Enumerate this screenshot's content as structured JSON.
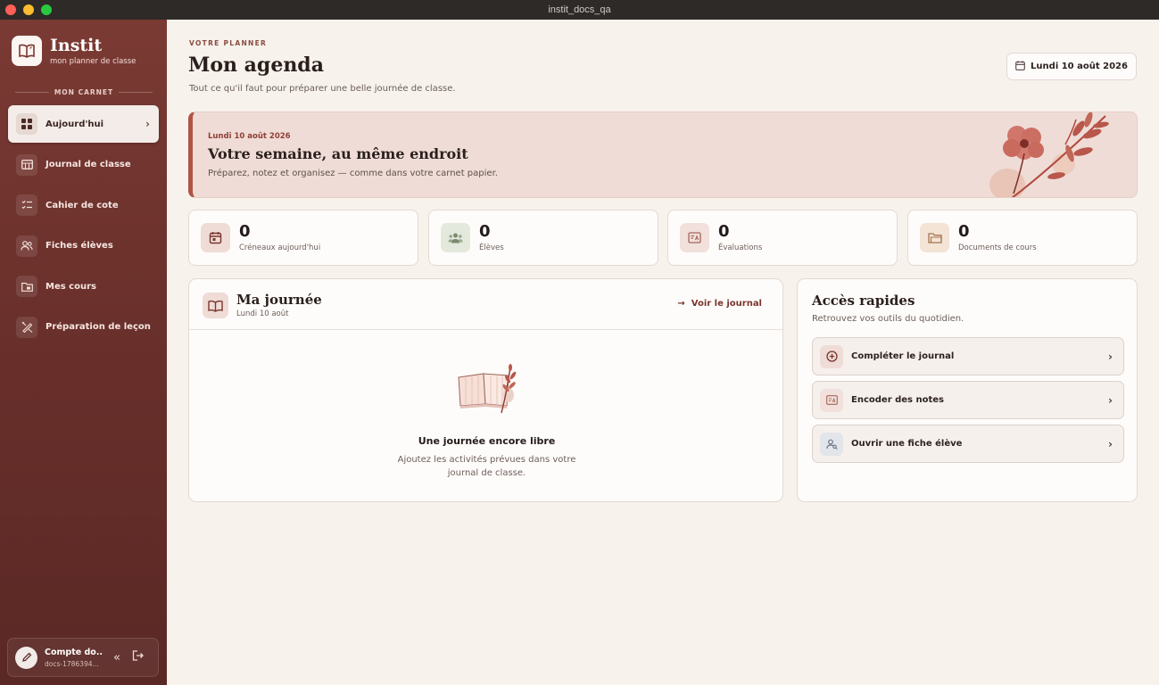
{
  "window": {
    "title": "instit_docs_qa"
  },
  "sidebar": {
    "brand": {
      "name": "Instit",
      "subtitle": "mon planner de classe"
    },
    "section_label": "MON CARNET",
    "items": [
      {
        "label": "Aujourd'hui",
        "icon": "grid-icon",
        "active": true
      },
      {
        "label": "Journal de classe",
        "icon": "table-icon"
      },
      {
        "label": "Cahier de cote",
        "icon": "checklist-icon"
      },
      {
        "label": "Fiches élèves",
        "icon": "users-icon"
      },
      {
        "label": "Mes cours",
        "icon": "folder-icon"
      },
      {
        "label": "Préparation de leçon",
        "icon": "pen-ruler-icon"
      }
    ],
    "account": {
      "name": "Compte do...",
      "email": "docs-1786394..."
    }
  },
  "header": {
    "eyebrow": "VOTRE PLANNER",
    "title": "Mon agenda",
    "subtitle": "Tout ce qu'il faut pour préparer une belle journée de classe.",
    "date_button": "Lundi 10 août 2026"
  },
  "banner": {
    "date": "Lundi 10 août 2026",
    "title": "Votre semaine, au même endroit",
    "subtitle": "Préparez, notez et organisez — comme dans votre carnet papier."
  },
  "stats": [
    {
      "value": "0",
      "label": "Créneaux aujourd'hui",
      "icon": "calendar-icon",
      "color": "#efdcd7"
    },
    {
      "value": "0",
      "label": "Élèves",
      "icon": "users-icon",
      "color": "#e3e9dd"
    },
    {
      "value": "0",
      "label": "Évaluations",
      "icon": "grade-icon",
      "color": "#f1e0dc"
    },
    {
      "value": "0",
      "label": "Documents de cours",
      "icon": "folder-icon",
      "color": "#f3e4d6"
    }
  ],
  "journal": {
    "title": "Ma journée",
    "subtitle": "Lundi 10 août",
    "link": "Voir le journal",
    "empty_title": "Une journée encore libre",
    "empty_text": "Ajoutez les activités prévues dans votre journal de classe."
  },
  "quick": {
    "title": "Accès rapides",
    "subtitle": "Retrouvez vos outils du quotidien.",
    "items": [
      {
        "label": "Compléter le journal",
        "icon": "plus-circle-icon",
        "color": "#efdcd7"
      },
      {
        "label": "Encoder des notes",
        "icon": "grade-icon",
        "color": "#f1e0dc"
      },
      {
        "label": "Ouvrir une fiche élève",
        "icon": "user-search-icon",
        "color": "#e2e5ea"
      }
    ]
  },
  "colors": {
    "accent": "#b05446",
    "sidebar": "#6a302b",
    "background": "#f7f2ec"
  }
}
